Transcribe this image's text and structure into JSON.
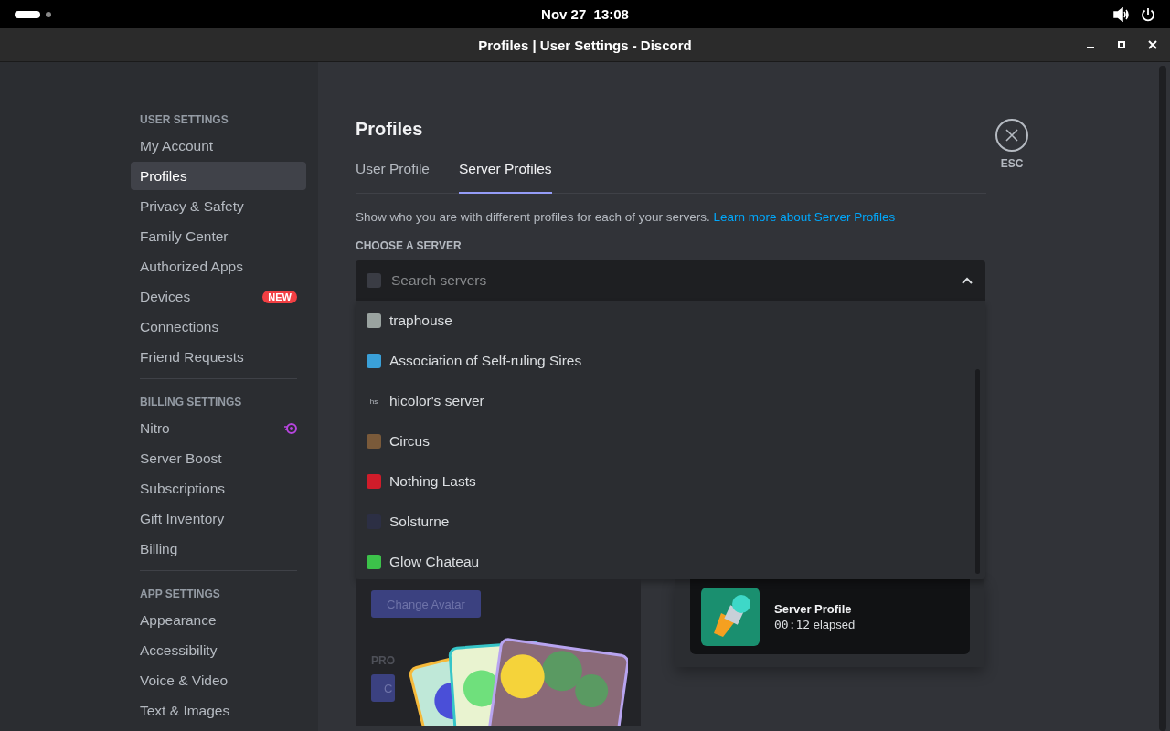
{
  "top_bar": {
    "clock": "Nov 27  13:08"
  },
  "window": {
    "title": "Profiles | User Settings - Discord"
  },
  "sidebar": {
    "sections": [
      {
        "heading": "USER SETTINGS",
        "items": [
          {
            "label": "My Account",
            "selected": false
          },
          {
            "label": "Profiles",
            "selected": true
          },
          {
            "label": "Privacy & Safety",
            "selected": false
          },
          {
            "label": "Family Center",
            "selected": false
          },
          {
            "label": "Authorized Apps",
            "selected": false
          },
          {
            "label": "Devices",
            "selected": false,
            "badge": "NEW"
          },
          {
            "label": "Connections",
            "selected": false
          },
          {
            "label": "Friend Requests",
            "selected": false
          }
        ]
      },
      {
        "heading": "BILLING SETTINGS",
        "items": [
          {
            "label": "Nitro",
            "selected": false,
            "nitro_icon": true
          },
          {
            "label": "Server Boost",
            "selected": false
          },
          {
            "label": "Subscriptions",
            "selected": false
          },
          {
            "label": "Gift Inventory",
            "selected": false
          },
          {
            "label": "Billing",
            "selected": false
          }
        ]
      },
      {
        "heading": "APP SETTINGS",
        "items": [
          {
            "label": "Appearance",
            "selected": false
          },
          {
            "label": "Accessibility",
            "selected": false
          },
          {
            "label": "Voice & Video",
            "selected": false
          },
          {
            "label": "Text & Images",
            "selected": false
          }
        ]
      }
    ]
  },
  "page": {
    "title": "Profiles",
    "tabs": [
      {
        "label": "User Profile",
        "selected": false
      },
      {
        "label": "Server Profiles",
        "selected": true
      }
    ],
    "description": "Show who you are with different profiles for each of your servers.",
    "link": "Learn more about Server Profiles",
    "choose_label": "CHOOSE A SERVER",
    "search": {
      "placeholder": "Search servers",
      "expanded": true
    },
    "servers": [
      {
        "name": "traphouse",
        "color": "#9aa3a0"
      },
      {
        "name": "Association of Self-ruling Sires",
        "color": "#3aa0d8"
      },
      {
        "name": "hicolor's server",
        "acronym": "hs"
      },
      {
        "name": "Circus",
        "color": "#7a5a3a"
      },
      {
        "name": "Nothing Lasts",
        "color": "#d01c2a"
      },
      {
        "name": "Solsturne",
        "color": "#2c2f44"
      },
      {
        "name": "Glow Chateau",
        "color": "#3cc24a"
      }
    ],
    "change_avatar": "Change Avatar",
    "profile_label": "PRO",
    "second_button": "C",
    "activity": {
      "title": "Server Profile",
      "timer": "00:12",
      "suffix": "elapsed"
    },
    "close": {
      "label": "ESC"
    }
  }
}
